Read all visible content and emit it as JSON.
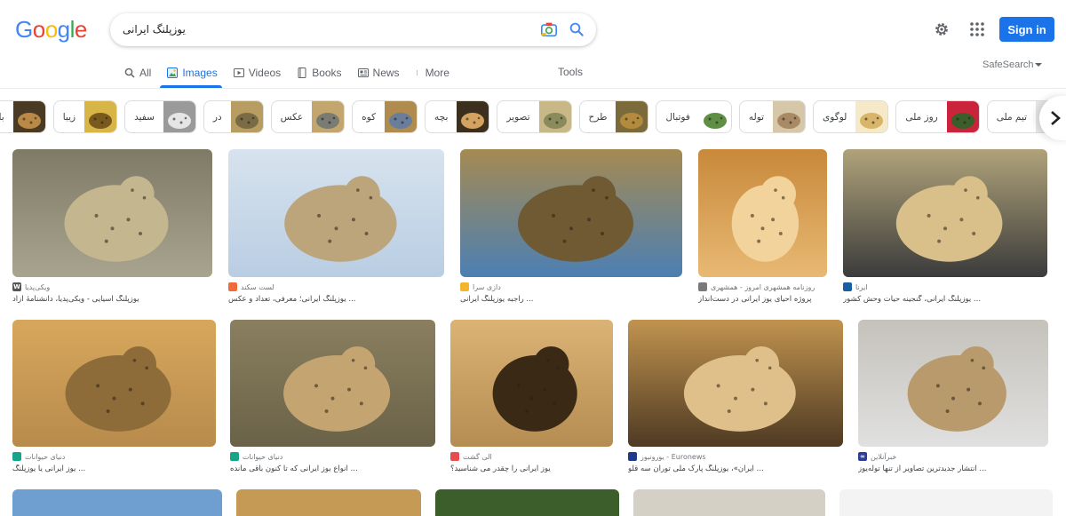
{
  "logo": [
    "G",
    "o",
    "o",
    "g",
    "l",
    "e"
  ],
  "search": {
    "value": "یوزپلنگ ایرانی"
  },
  "header": {
    "sign_in": "Sign in"
  },
  "tabs": [
    {
      "label": "All",
      "icon": "search-icon"
    },
    {
      "label": "Images",
      "icon": "image-icon"
    },
    {
      "label": "Videos",
      "icon": "video-icon"
    },
    {
      "label": "Books",
      "icon": "book-icon"
    },
    {
      "label": "News",
      "icon": "news-icon"
    },
    {
      "label": "More",
      "icon": "more-vert-icon"
    }
  ],
  "tools_label": "Tools",
  "safesearch_label": "SafeSearch",
  "chips": [
    "تیم ملی",
    "روز ملی",
    "لوگوی",
    "توله",
    "فوتبال",
    "طرح",
    "تصویر",
    "بچه",
    "کوه",
    "عکس",
    "در",
    "سفید",
    "زیبا",
    "با"
  ],
  "colors": {
    "accent": "#1a73e8",
    "cheetah_fur": "#c9a25a",
    "sky": "#b9cde3"
  },
  "results": [
    {
      "source": "ویکی‌پدیا",
      "title": "یوزپلنگ آسیایی - ویکی‌پدیا، دانشنامهٔ آزاد"
    },
    {
      "source": "لست سکند",
      "title": "یوزپلنگ ایرانی؛ معرفی، تعداد و عکس ..."
    },
    {
      "source": "دازی سرا",
      "title": "راجبه یوزپلنگ ایرانی ..."
    },
    {
      "source": "روزنامه همشهری امروز - همشهری",
      "title": "پروژه احیای یوز ایرانی در دست‌انداز"
    },
    {
      "source": "ایرنا",
      "title": "یوزپلنگ ایرانی، گنجینه حیات وحش کشور ..."
    },
    {
      "source": "دنیای حیوانات",
      "title": "یوز ایرانی یا یوزپلنگ ..."
    },
    {
      "source": "دنیای حیوانات",
      "title": "انواع یوز ایرانی که تا کنون باقی مانده ..."
    },
    {
      "source": "الی گشت",
      "title": "یوز ایرانی را چقدر می شناسید؟"
    },
    {
      "source": "یورونیوز - Euronews",
      "title": "ایران»، یوزپلنگ پارک ملی توران سه قلو ..."
    },
    {
      "source": "خبرآنلاین",
      "title": "انتشار جدیدترین تصاویر از تنها توله‌یوز ..."
    }
  ]
}
